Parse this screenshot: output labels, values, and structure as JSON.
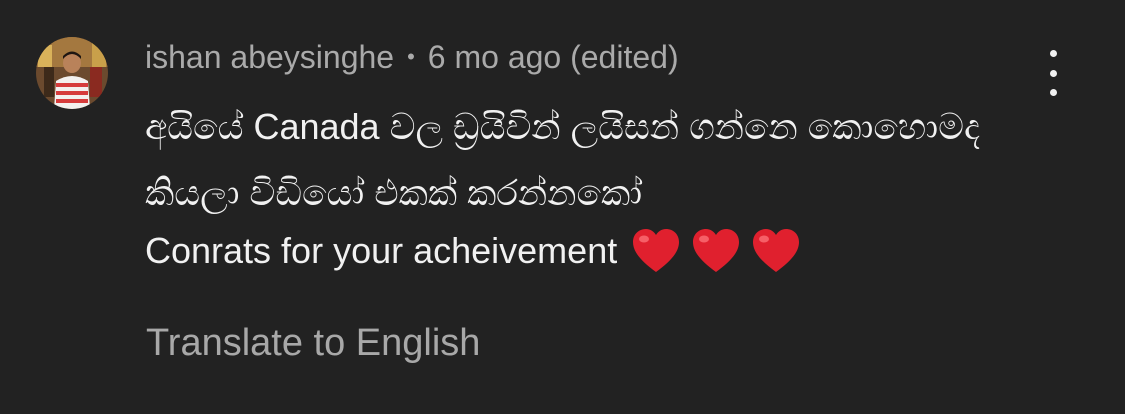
{
  "comment": {
    "author": "ishan abeysinghe",
    "separator": "•",
    "timestamp": "6 mo ago (edited)",
    "text_line1": "අයියේ  Canada වල ඩ්‍රයිවින් ලයිසන්  ගන්නෙ කොහොමද",
    "text_line2": "කියලා විඩියෝ  එකක්  කරන්නකෝ",
    "text_line3": "Conrats for your acheivement",
    "hearts": [
      "❤️",
      "❤️",
      "❤️"
    ],
    "heart_color": "#e0202e",
    "translate_label": "Translate to English",
    "menu_icon": "more-vertical-icon",
    "avatar_icon": "user-avatar-photo"
  },
  "colors": {
    "background": "#222222",
    "primary_text": "#f1f1f1",
    "secondary_text": "#aaaaaa"
  }
}
